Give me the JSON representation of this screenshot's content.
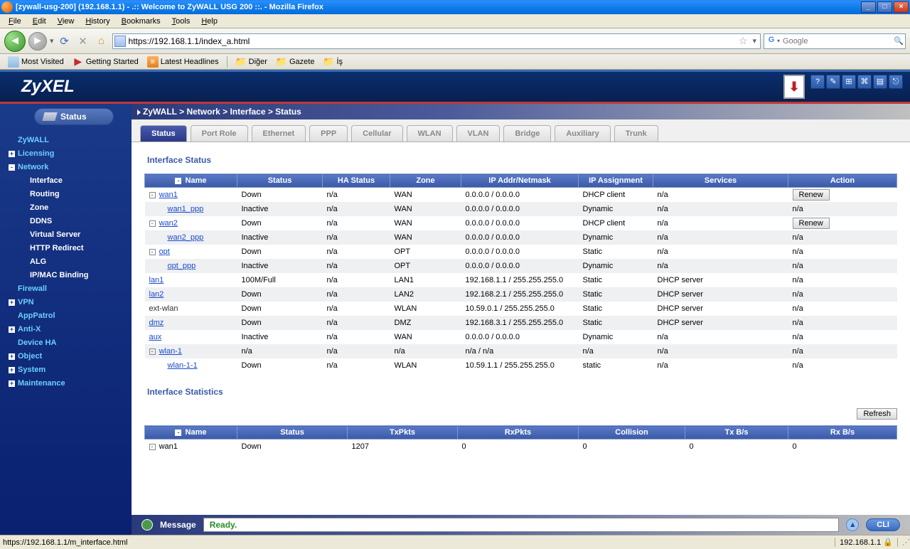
{
  "window": {
    "title": "[zywall-usg-200] (192.168.1.1) - .:: Welcome to ZyWALL USG 200 ::. - Mozilla Firefox"
  },
  "menubar": [
    "File",
    "Edit",
    "View",
    "History",
    "Bookmarks",
    "Tools",
    "Help"
  ],
  "nav": {
    "url": "https://192.168.1.1/index_a.html",
    "search_placeholder": "Google"
  },
  "bookmarks": [
    {
      "icon": "blue",
      "label": "Most Visited"
    },
    {
      "icon": "red",
      "label": "Getting Started"
    },
    {
      "icon": "orange",
      "label": "Latest Headlines"
    },
    {
      "icon": "folder",
      "label": "Diğer",
      "sep_before": true
    },
    {
      "icon": "folder",
      "label": "Gazete"
    },
    {
      "icon": "folder",
      "label": "İş"
    }
  ],
  "brand": "ZyXEL",
  "breadcrumb": "ZyWALL > Network > Interface > Status",
  "sidebar": {
    "status_label": "Status",
    "nodes": [
      {
        "label": "ZyWALL",
        "level": 1,
        "expand": null
      },
      {
        "label": "Licensing",
        "level": 1,
        "expand": "+"
      },
      {
        "label": "Network",
        "level": 1,
        "expand": "-",
        "selected": true
      },
      {
        "label": "Interface",
        "level": 2,
        "selected": true
      },
      {
        "label": "Routing",
        "level": 2
      },
      {
        "label": "Zone",
        "level": 2
      },
      {
        "label": "DDNS",
        "level": 2
      },
      {
        "label": "Virtual Server",
        "level": 2
      },
      {
        "label": "HTTP Redirect",
        "level": 2
      },
      {
        "label": "ALG",
        "level": 2
      },
      {
        "label": "IP/MAC Binding",
        "level": 2
      },
      {
        "label": "Firewall",
        "level": 1,
        "expand": null
      },
      {
        "label": "VPN",
        "level": 1,
        "expand": "+"
      },
      {
        "label": "AppPatrol",
        "level": 1,
        "expand": null
      },
      {
        "label": "Anti-X",
        "level": 1,
        "expand": "+"
      },
      {
        "label": "Device HA",
        "level": 1,
        "expand": null
      },
      {
        "label": "Object",
        "level": 1,
        "expand": "+"
      },
      {
        "label": "System",
        "level": 1,
        "expand": "+"
      },
      {
        "label": "Maintenance",
        "level": 1,
        "expand": "+"
      }
    ]
  },
  "tabs": [
    "Status",
    "Port Role",
    "Ethernet",
    "PPP",
    "Cellular",
    "WLAN",
    "VLAN",
    "Bridge",
    "Auxiliary",
    "Trunk"
  ],
  "interface_status": {
    "title": "Interface Status",
    "headers": [
      "Name",
      "Status",
      "HA Status",
      "Zone",
      "IP Addr/Netmask",
      "IP Assignment",
      "Services",
      "Action"
    ],
    "rows": [
      {
        "exp": "-",
        "name": "wan1",
        "link": true,
        "status": "Down",
        "ha": "n/a",
        "zone": "WAN",
        "ip": "0.0.0.0 / 0.0.0.0",
        "ipa": "DHCP client",
        "svc": "n/a",
        "action": "Renew"
      },
      {
        "indent": true,
        "name": "wan1_ppp",
        "link": true,
        "status": "Inactive",
        "ha": "n/a",
        "zone": "WAN",
        "ip": "0.0.0.0 / 0.0.0.0",
        "ipa": "Dynamic",
        "svc": "n/a",
        "action_text": "n/a"
      },
      {
        "exp": "-",
        "name": "wan2",
        "link": true,
        "status": "Down",
        "ha": "n/a",
        "zone": "WAN",
        "ip": "0.0.0.0 / 0.0.0.0",
        "ipa": "DHCP client",
        "svc": "n/a",
        "action": "Renew"
      },
      {
        "indent": true,
        "name": "wan2_ppp",
        "link": true,
        "status": "Inactive",
        "ha": "n/a",
        "zone": "WAN",
        "ip": "0.0.0.0 / 0.0.0.0",
        "ipa": "Dynamic",
        "svc": "n/a",
        "action_text": "n/a"
      },
      {
        "exp": "-",
        "name": "opt",
        "link": true,
        "status": "Down",
        "ha": "n/a",
        "zone": "OPT",
        "ip": "0.0.0.0 / 0.0.0.0",
        "ipa": "Static",
        "svc": "n/a",
        "action_text": "n/a"
      },
      {
        "indent": true,
        "name": "opt_ppp",
        "link": true,
        "status": "Inactive",
        "ha": "n/a",
        "zone": "OPT",
        "ip": "0.0.0.0 / 0.0.0.0",
        "ipa": "Dynamic",
        "svc": "n/a",
        "action_text": "n/a"
      },
      {
        "name": "lan1",
        "link": true,
        "status": "100M/Full",
        "ha": "n/a",
        "zone": "LAN1",
        "ip": "192.168.1.1 / 255.255.255.0",
        "ipa": "Static",
        "svc": "DHCP server",
        "action_text": "n/a"
      },
      {
        "name": "lan2",
        "link": true,
        "status": "Down",
        "ha": "n/a",
        "zone": "LAN2",
        "ip": "192.168.2.1 / 255.255.255.0",
        "ipa": "Static",
        "svc": "DHCP server",
        "action_text": "n/a"
      },
      {
        "name": "ext-wlan",
        "link": false,
        "status": "Down",
        "ha": "n/a",
        "zone": "WLAN",
        "ip": "10.59.0.1 / 255.255.255.0",
        "ipa": "Static",
        "svc": "DHCP server",
        "action_text": "n/a"
      },
      {
        "name": "dmz",
        "link": true,
        "status": "Down",
        "ha": "n/a",
        "zone": "DMZ",
        "ip": "192.168.3.1 / 255.255.255.0",
        "ipa": "Static",
        "svc": "DHCP server",
        "action_text": "n/a"
      },
      {
        "name": "aux",
        "link": true,
        "status": "Inactive",
        "ha": "n/a",
        "zone": "WAN",
        "ip": "0.0.0.0 / 0.0.0.0",
        "ipa": "Dynamic",
        "svc": "n/a",
        "action_text": "n/a"
      },
      {
        "exp": "-",
        "name": "wlan-1",
        "link": true,
        "status": "n/a",
        "ha": "n/a",
        "zone": "n/a",
        "ip": "n/a / n/a",
        "ipa": "n/a",
        "svc": "n/a",
        "action_text": "n/a"
      },
      {
        "indent": true,
        "name": "wlan-1-1",
        "link": true,
        "status": "Down",
        "ha": "n/a",
        "zone": "WLAN",
        "ip": "10.59.1.1 / 255.255.255.0",
        "ipa": "static",
        "svc": "n/a",
        "action_text": "n/a"
      }
    ]
  },
  "interface_stats": {
    "title": "Interface Statistics",
    "refresh": "Refresh",
    "headers": [
      "Name",
      "Status",
      "TxPkts",
      "RxPkts",
      "Collision",
      "Tx B/s",
      "Rx B/s"
    ],
    "rows": [
      {
        "exp": "-",
        "name": "wan1",
        "status": "Down",
        "tx": "1207",
        "rx": "0",
        "coll": "0",
        "txb": "0",
        "rxb": "0"
      }
    ]
  },
  "message": {
    "label": "Message",
    "text": "Ready.",
    "cli": "CLI"
  },
  "statusbar": {
    "left": "https://192.168.1.1/m_interface.html",
    "right": "192.168.1.1"
  }
}
